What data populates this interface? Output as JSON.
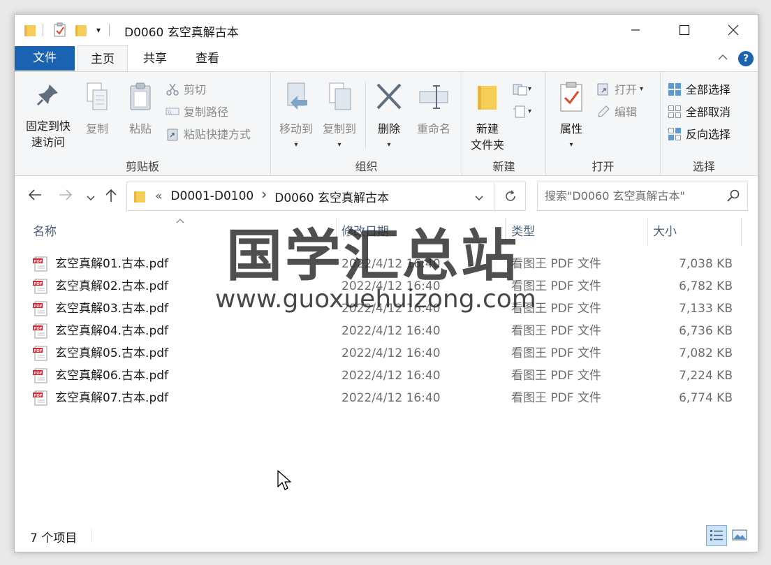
{
  "window": {
    "title": "D0060 玄空真解古本"
  },
  "ribbon_tabs": [
    {
      "label": "文件"
    },
    {
      "label": "主页"
    },
    {
      "label": "共享"
    },
    {
      "label": "查看"
    }
  ],
  "ribbon": {
    "clipboard": {
      "label": "剪贴板",
      "pin": "固定到快速访问",
      "pin_line1": "固定到快",
      "pin_line2": "速访问",
      "copy": "复制",
      "paste": "粘贴",
      "cut": "剪切",
      "copy_path": "复制路径",
      "paste_shortcut": "粘贴快捷方式"
    },
    "organize": {
      "label": "组织",
      "move_to": "移动到",
      "copy_to": "复制到",
      "delete": "删除",
      "rename": "重命名"
    },
    "new": {
      "label": "新建",
      "new_folder_line1": "新建",
      "new_folder_line2": "文件夹"
    },
    "open": {
      "label": "打开",
      "properties": "属性",
      "open": "打开",
      "edit": "编辑"
    },
    "select": {
      "label": "选择",
      "select_all": "全部选择",
      "select_none": "全部取消",
      "invert": "反向选择"
    }
  },
  "address": {
    "overflow": "«",
    "crumbs": [
      "D0001-D0100",
      "D0060 玄空真解古本"
    ],
    "search_placeholder": "搜索\"D0060 玄空真解古本\""
  },
  "columns": {
    "name": "名称",
    "date": "修改日期",
    "type": "类型",
    "size": "大小"
  },
  "files": [
    {
      "name": "玄空真解01.古本.pdf",
      "date": "2022/4/12 16:40",
      "type": "看图王 PDF 文件",
      "size": "7,038 KB"
    },
    {
      "name": "玄空真解02.古本.pdf",
      "date": "2022/4/12 16:40",
      "type": "看图王 PDF 文件",
      "size": "6,782 KB"
    },
    {
      "name": "玄空真解03.古本.pdf",
      "date": "2022/4/12 16:40",
      "type": "看图王 PDF 文件",
      "size": "7,133 KB"
    },
    {
      "name": "玄空真解04.古本.pdf",
      "date": "2022/4/12 16:40",
      "type": "看图王 PDF 文件",
      "size": "6,736 KB"
    },
    {
      "name": "玄空真解05.古本.pdf",
      "date": "2022/4/12 16:40",
      "type": "看图王 PDF 文件",
      "size": "7,082 KB"
    },
    {
      "name": "玄空真解06.古本.pdf",
      "date": "2022/4/12 16:40",
      "type": "看图王 PDF 文件",
      "size": "7,224 KB"
    },
    {
      "name": "玄空真解07.古本.pdf",
      "date": "2022/4/12 16:40",
      "type": "看图王 PDF 文件",
      "size": "6,774 KB"
    }
  ],
  "status": {
    "count": "7 个项目"
  },
  "watermark": {
    "title": "国学汇总站",
    "url": "www.guoxuehuizong.com"
  },
  "colors": {
    "accent": "#1a63b3",
    "folder": "#f6cd58",
    "pdf_red": "#d9232e"
  }
}
